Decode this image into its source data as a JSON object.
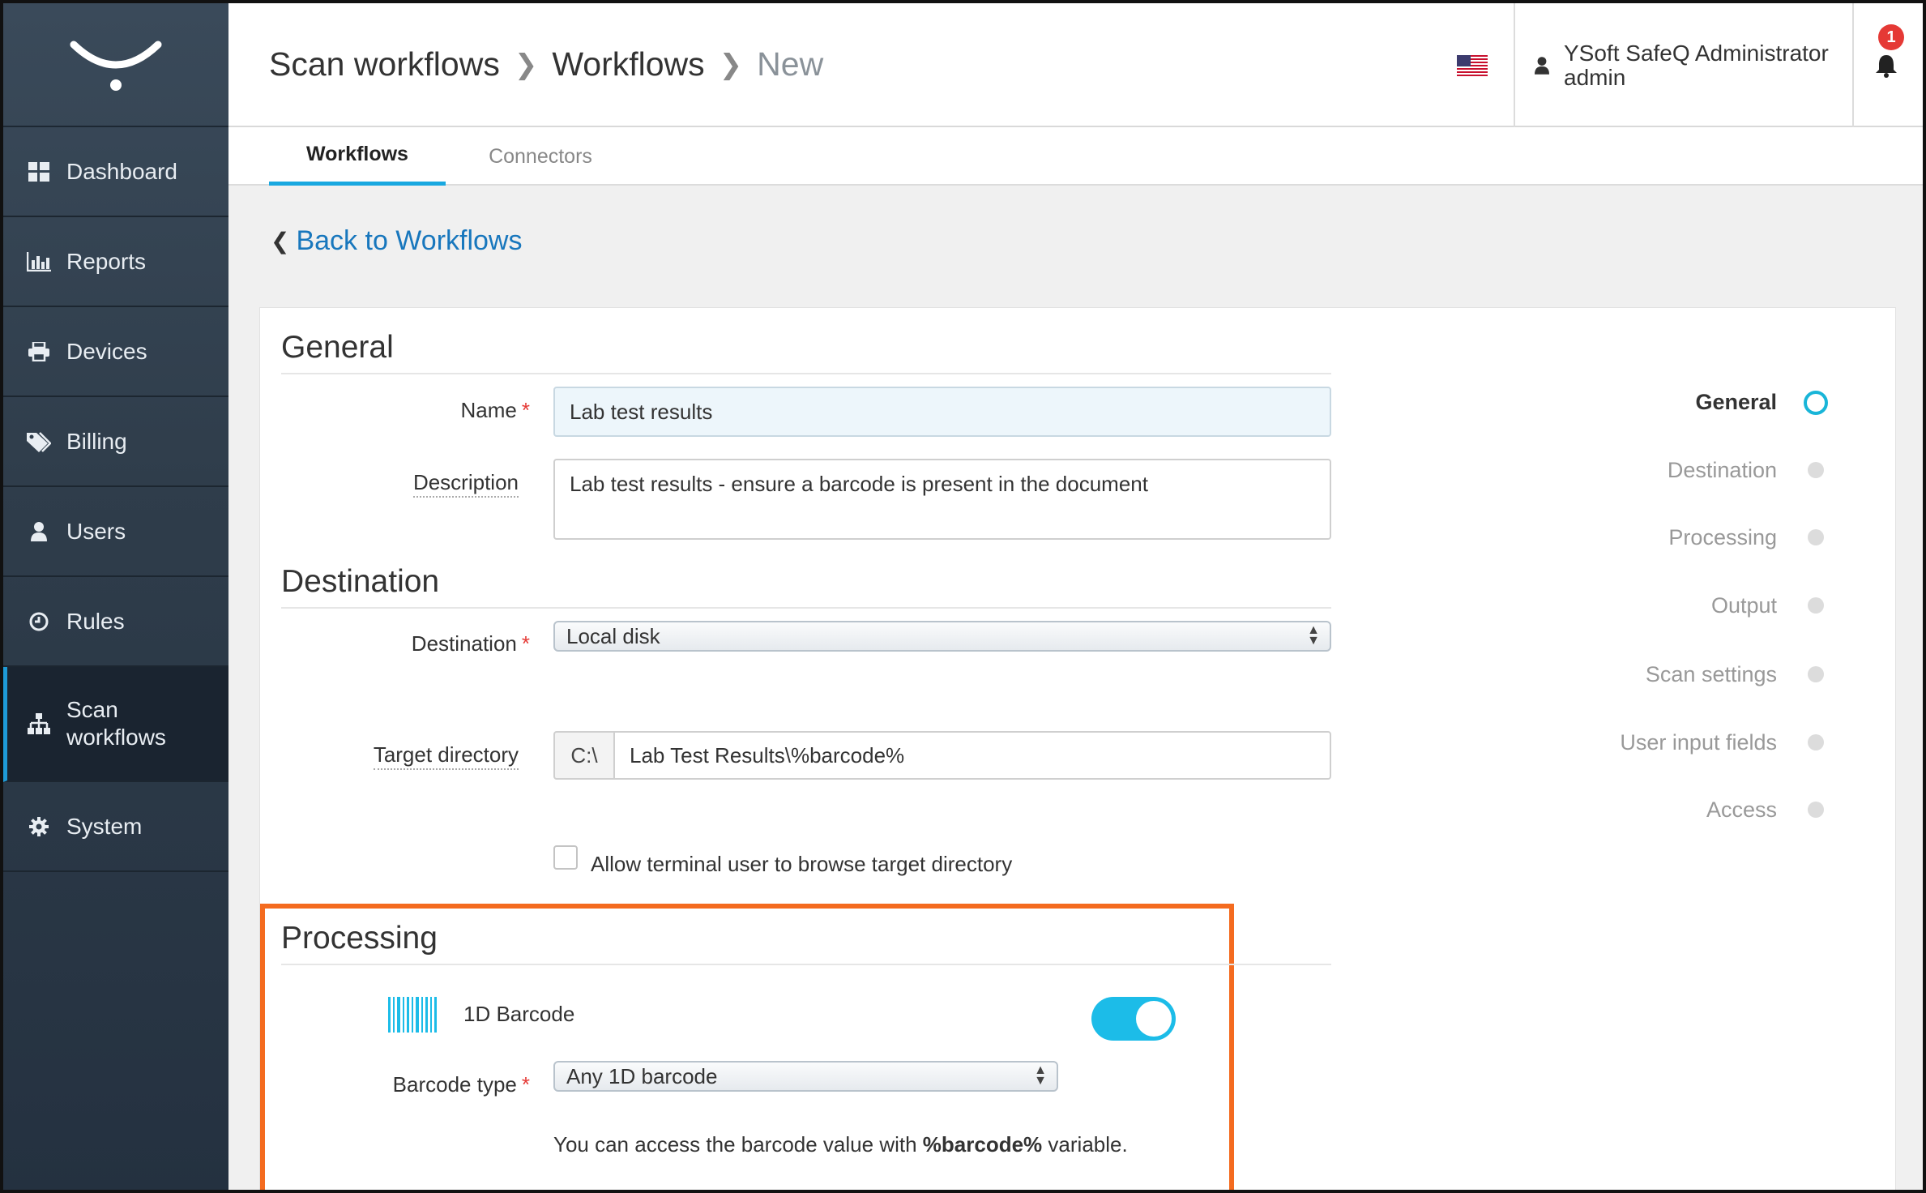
{
  "sidebar": {
    "logo_icon": "ysoft-smile-logo",
    "items": [
      {
        "label": "Dashboard",
        "icon": "dashboard-grid-icon"
      },
      {
        "label": "Reports",
        "icon": "bar-chart-icon"
      },
      {
        "label": "Devices",
        "icon": "printer-icon"
      },
      {
        "label": "Billing",
        "icon": "tags-icon"
      },
      {
        "label": "Users",
        "icon": "user-icon"
      },
      {
        "label": "Rules",
        "icon": "clock-icon"
      },
      {
        "label": "Scan workflows",
        "icon": "sitemap-icon"
      },
      {
        "label": "System",
        "icon": "gear-icon"
      }
    ],
    "active_index": 6
  },
  "header": {
    "breadcrumb": [
      "Scan workflows",
      "Workflows",
      "New"
    ],
    "language_flag": "us-flag-icon",
    "user_name": "YSoft SafeQ Administrator",
    "user_login": "admin",
    "notification_count": "1"
  },
  "tabs": [
    {
      "label": "Workflows",
      "active": true
    },
    {
      "label": "Connectors",
      "active": false
    }
  ],
  "back_link": "Back to Workflows",
  "general": {
    "title": "General",
    "name_label": "Name",
    "name_value": "Lab test results",
    "description_label": "Description",
    "description_value": "Lab test results - ensure a barcode is present in the document"
  },
  "destination": {
    "title": "Destination",
    "destination_label": "Destination",
    "destination_value": "Local disk",
    "target_label": "Target directory",
    "target_prefix": "C:\\",
    "target_value": "Lab Test Results\\%barcode%",
    "browse_label": "Allow terminal user to browse target directory"
  },
  "processing": {
    "title": "Processing",
    "barcode_label": "1D Barcode",
    "barcode_enabled": true,
    "barcode_type_label": "Barcode type",
    "barcode_type_value": "Any 1D barcode",
    "note_prefix": "You can access the barcode value with",
    "note_variable": "%barcode%",
    "note_suffix": "variable."
  },
  "stepper": [
    {
      "label": "General",
      "active": true
    },
    {
      "label": "Destination",
      "active": false
    },
    {
      "label": "Processing",
      "active": false
    },
    {
      "label": "Output",
      "active": false
    },
    {
      "label": "Scan settings",
      "active": false
    },
    {
      "label": "User input fields",
      "active": false
    },
    {
      "label": "Access",
      "active": false
    }
  ],
  "colors": {
    "accent": "#19a8e0",
    "link": "#1877bd",
    "highlight": "#f46b1f",
    "required": "#e53935"
  }
}
